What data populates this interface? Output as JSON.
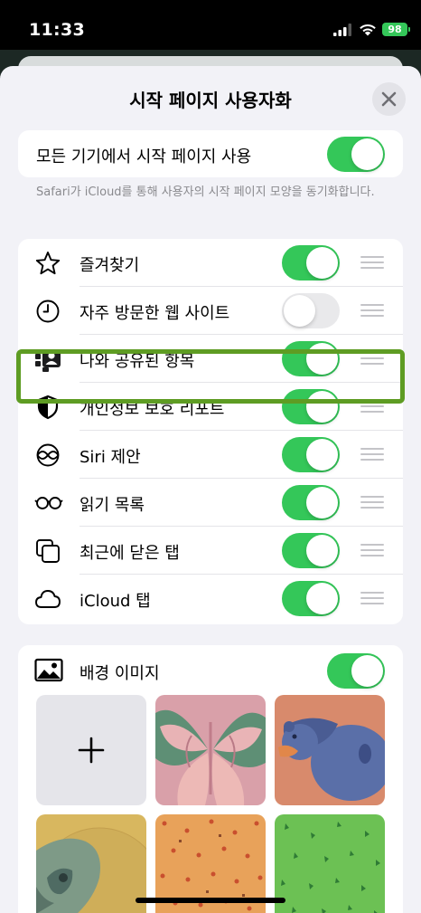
{
  "status": {
    "time": "11:33",
    "battery": "98"
  },
  "sheet": {
    "title": "시작 페이지 사용자화"
  },
  "sync": {
    "label": "모든 기기에서 시작 페이지 사용",
    "enabled": true,
    "footer": "Safari가 iCloud를 통해 사용자의 시작 페이지 모양을 동기화합니다."
  },
  "sections": [
    {
      "label": "즐겨찾기",
      "icon": "star-icon",
      "enabled": true
    },
    {
      "label": "자주 방문한 웹 사이트",
      "icon": "clock-icon",
      "enabled": false
    },
    {
      "label": "나와 공유된 항목",
      "icon": "shared-with-you-icon",
      "enabled": true
    },
    {
      "label": "개인정보 보호 리포트",
      "icon": "shield-icon",
      "enabled": true
    },
    {
      "label": "Siri 제안",
      "icon": "siri-icon",
      "enabled": true
    },
    {
      "label": "읽기 목록",
      "icon": "glasses-icon",
      "enabled": true
    },
    {
      "label": "최근에 닫은 탭",
      "icon": "tabs-icon",
      "enabled": true
    },
    {
      "label": "iCloud 탭",
      "icon": "cloud-icon",
      "enabled": true
    }
  ],
  "background": {
    "label": "배경 이미지",
    "enabled": true,
    "tiles": [
      "add",
      "butterfly",
      "bear",
      "parrot",
      "orange-pattern",
      "green-pattern"
    ]
  },
  "colors": {
    "accent_green": "#34c759",
    "highlight": "#5e9c23"
  }
}
